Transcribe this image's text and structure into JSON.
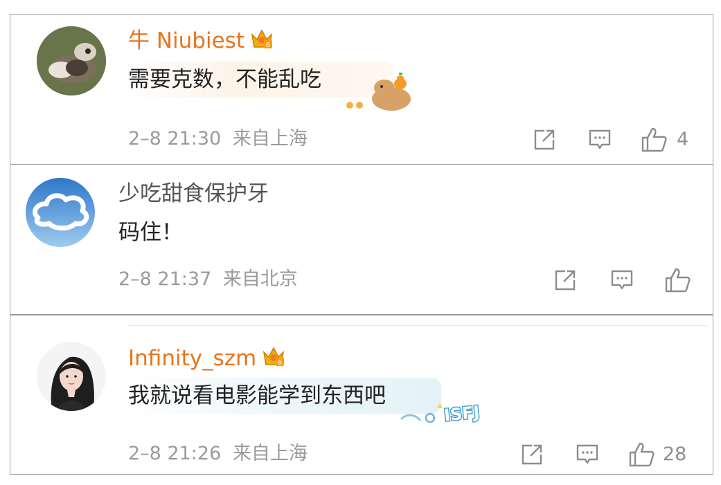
{
  "comments": [
    {
      "user": "牛 Niubiest",
      "text": "需要克数，不能乱吃",
      "time": "2–8 21:30",
      "location": "来自上海",
      "likes": "4",
      "badge": "6"
    },
    {
      "user": "少吃甜食保护牙",
      "text": "码住！",
      "time": "2–8 21:37",
      "location": "来自北京",
      "likes": ""
    },
    {
      "user": "Infinity_szm",
      "text": "我就说看电影能学到东西吧",
      "time": "2–8 21:26",
      "location": "来自上海",
      "likes": "28",
      "badge": "6",
      "sticker_text": "ISFJ"
    }
  ],
  "icons": {
    "share": "share-icon",
    "reply": "comment-icon",
    "like": "thumbs-up-icon"
  },
  "colors": {
    "username": "#e8741a",
    "meta": "#9a9a9a",
    "border": "#9b9b9b",
    "text": "#222222"
  }
}
